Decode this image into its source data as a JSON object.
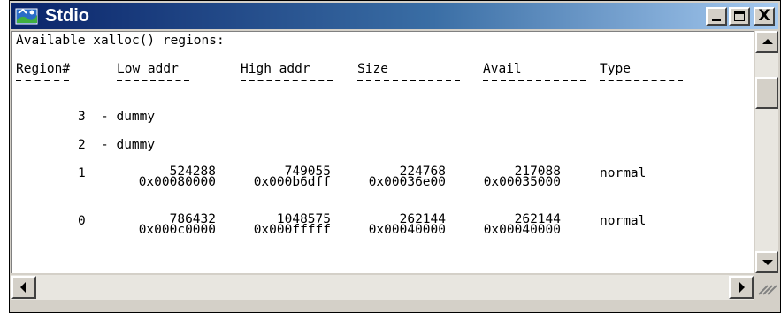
{
  "window": {
    "title": "Stdio",
    "close_glyph": "X"
  },
  "console": {
    "heading": "Available xalloc() regions:",
    "columns": [
      "Region#",
      "Low addr",
      "High addr",
      "Size",
      "Avail",
      "Type"
    ],
    "dummy_rows": [
      {
        "region": "3",
        "text": "- dummy"
      },
      {
        "region": "2",
        "text": "- dummy"
      }
    ],
    "rows": [
      {
        "region": "1",
        "low": "524288",
        "low_hex": "0x00080000",
        "high": "749055",
        "high_hex": "0x000b6dff",
        "size": "224768",
        "size_hex": "0x00036e00",
        "avail": "217088",
        "avail_hex": "0x00035000",
        "type": "normal"
      },
      {
        "region": "0",
        "low": "786432",
        "low_hex": "0x000c0000",
        "high": "1048575",
        "high_hex": "0x000fffff",
        "size": "262144",
        "size_hex": "0x00040000",
        "avail": "262144",
        "avail_hex": "0x00040000",
        "type": "normal"
      }
    ]
  },
  "icons": {
    "app": "stdio-app-icon",
    "minimize": "minimize-icon",
    "maximize": "maximize-icon",
    "close": "close-icon",
    "up": "arrow-up-icon",
    "down": "arrow-down-icon",
    "left": "arrow-left-icon",
    "right": "arrow-right-icon"
  },
  "colors": {
    "titlebar_start": "#0a246a",
    "titlebar_end": "#a6caf0",
    "face": "#d4d0c8",
    "console_bg": "#ffffff"
  }
}
